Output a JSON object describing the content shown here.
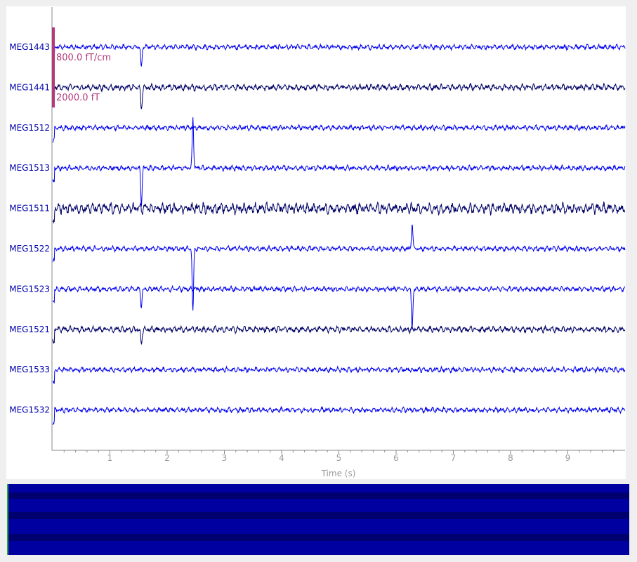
{
  "window": {
    "background": "#efefef",
    "plot_background": "#ffffff",
    "overview_background": "#0000a0"
  },
  "chart_data": {
    "type": "line",
    "xlabel": "Time (s)",
    "xlim": [
      0,
      10
    ],
    "x_ticks": [
      1,
      2,
      3,
      4,
      5,
      6,
      7,
      8,
      9
    ],
    "x_tick_labels": [
      "1",
      "2",
      "3",
      "4",
      "5",
      "6",
      "7",
      "8",
      "9"
    ],
    "channels": [
      {
        "name": "MEG1443",
        "color": "#0000ee",
        "kind": "grad"
      },
      {
        "name": "MEG1441",
        "color": "#000066",
        "kind": "mag"
      },
      {
        "name": "MEG1512",
        "color": "#0000ee",
        "kind": "grad"
      },
      {
        "name": "MEG1513",
        "color": "#0000ee",
        "kind": "grad"
      },
      {
        "name": "MEG1511",
        "color": "#000066",
        "kind": "mag"
      },
      {
        "name": "MEG1522",
        "color": "#0000ee",
        "kind": "grad"
      },
      {
        "name": "MEG1523",
        "color": "#0000ee",
        "kind": "grad"
      },
      {
        "name": "MEG1521",
        "color": "#000066",
        "kind": "mag"
      },
      {
        "name": "MEG1533",
        "color": "#0000ee",
        "kind": "grad"
      },
      {
        "name": "MEG1532",
        "color": "#0000ee",
        "kind": "grad"
      }
    ],
    "events": [
      {
        "channel": "MEG1443",
        "t": 1.55,
        "amplitude": -0.8
      },
      {
        "channel": "MEG1441",
        "t": 1.55,
        "amplitude": -0.9
      },
      {
        "channel": "MEG1513",
        "t": 1.55,
        "amplitude": -1.4
      },
      {
        "channel": "MEG1513",
        "t": 2.45,
        "amplitude": 2.0
      },
      {
        "channel": "MEG1522",
        "t": 2.45,
        "amplitude": -2.5
      },
      {
        "channel": "MEG1522",
        "t": 6.28,
        "amplitude": 1.0
      },
      {
        "channel": "MEG1523",
        "t": 6.28,
        "amplitude": -1.6
      },
      {
        "channel": "MEG1523",
        "t": 1.55,
        "amplitude": -0.7
      },
      {
        "channel": "MEG1521",
        "t": 1.55,
        "amplitude": -0.6
      }
    ],
    "scale_bars": [
      {
        "label": "800.0 fT/cm",
        "color": "#b23a7a"
      },
      {
        "label": "2000.0 fT",
        "color": "#b23a7a"
      }
    ]
  }
}
